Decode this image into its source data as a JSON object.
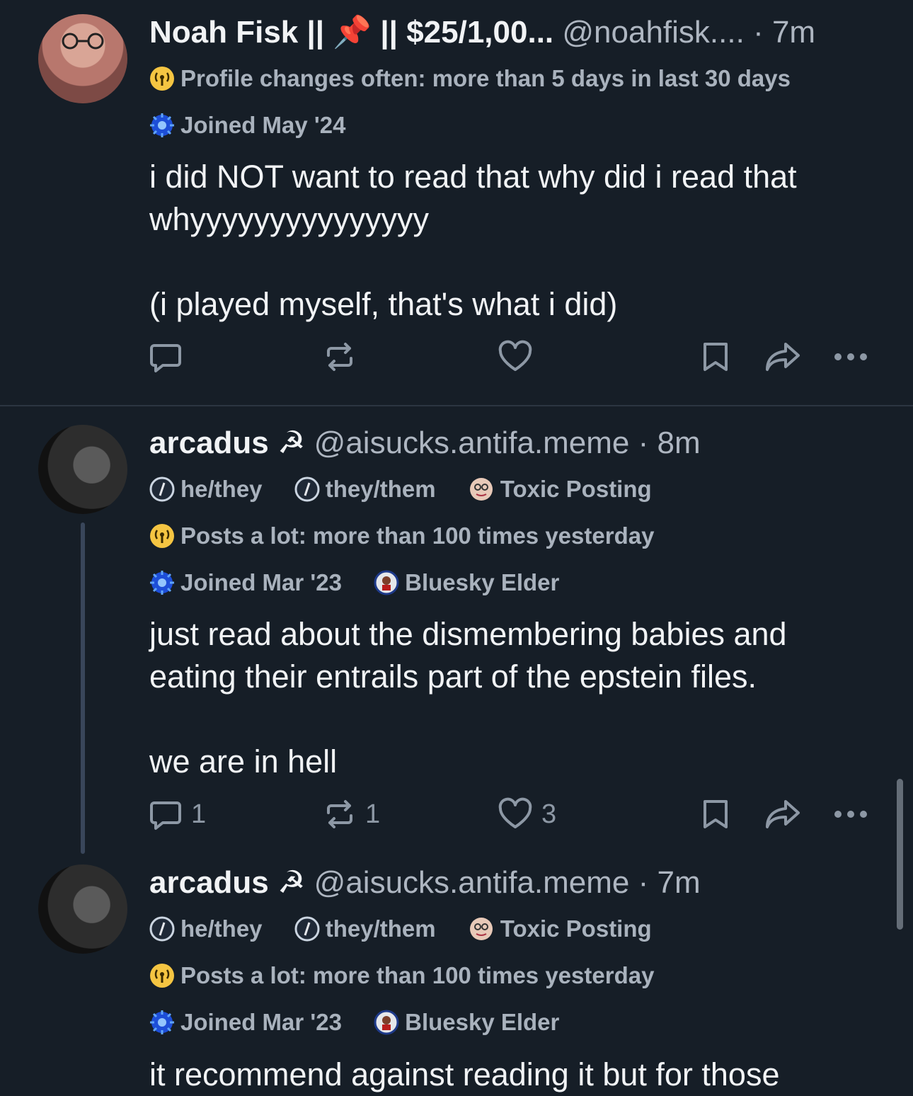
{
  "post1": {
    "name": "Noah Fisk || 📌 || $25/1,00...",
    "handle": "@noahfisk....",
    "time": "· 7m",
    "badge_profile_changes": "Profile changes often: more than 5 days in last 30 days",
    "badge_joined": "Joined May '24",
    "text_line1": "i did NOT want to read that why did i read that",
    "text_line2": "whyyyyyyyyyyyyyyy",
    "text_line3": "(i played myself, that's what i did)"
  },
  "post2": {
    "name": "arcadus ☭",
    "handle": "@aisucks.antifa.meme",
    "time": "· 8m",
    "badge_pronoun1": "he/they",
    "badge_pronoun2": "they/them",
    "badge_toxic": "Toxic Posting",
    "badge_posts_a_lot": "Posts a lot: more than 100 times yesterday",
    "badge_joined": "Joined Mar '23",
    "badge_elder": "Bluesky Elder",
    "text_line1": "just read about the dismembering babies and",
    "text_line2": "eating their entrails part of the epstein files.",
    "text_line3": "we are in hell",
    "reply_count": "1",
    "repost_count": "1",
    "like_count": "3"
  },
  "post3": {
    "name": "arcadus ☭",
    "handle": "@aisucks.antifa.meme",
    "time": "· 7m",
    "badge_pronoun1": "he/they",
    "badge_pronoun2": "they/them",
    "badge_toxic": "Toxic Posting",
    "badge_posts_a_lot": "Posts a lot: more than 100 times yesterday",
    "badge_joined": "Joined Mar '23",
    "badge_elder": "Bluesky Elder",
    "text_line1": "it recommend against reading it but for those"
  },
  "icons": {
    "reply": "reply-icon",
    "repost": "repost-icon",
    "like": "heart-icon",
    "bookmark": "bookmark-icon",
    "share": "share-icon",
    "more": "more-icon",
    "radio": "radio-broadcast-icon",
    "joined": "globe-join-icon",
    "pronoun": "pronoun-icon",
    "toxic": "toxic-face-icon",
    "elder": "elder-badge-icon"
  },
  "colors": {
    "background": "#161e27",
    "primary_text": "#f1f3f5",
    "secondary_text": "#aeb6c1",
    "action_icon": "#8d98a5",
    "badge_yellow": "#f5c542",
    "badge_blue": "#3b82f6"
  }
}
